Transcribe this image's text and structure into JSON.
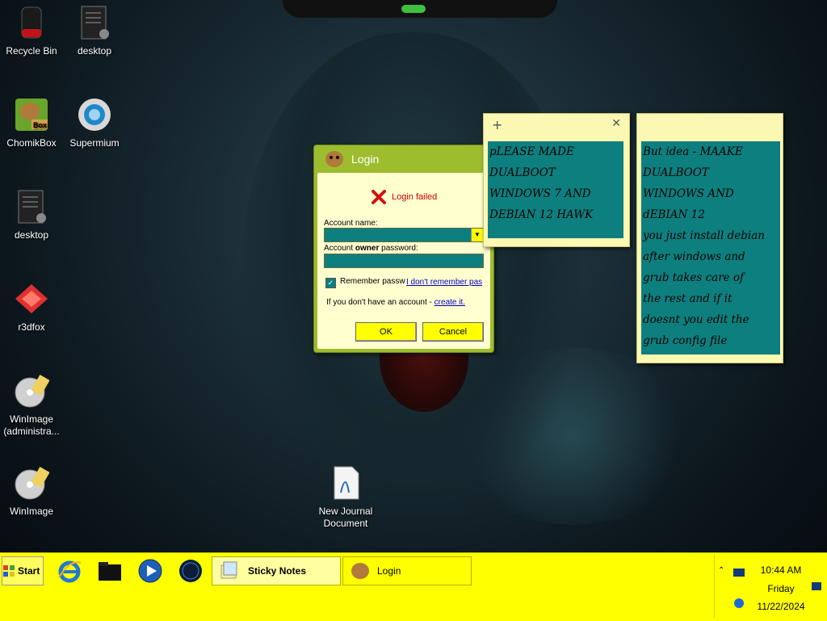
{
  "desktop": {
    "icons": [
      {
        "label": "Recycle Bin",
        "icon": "recycle-bin-icon"
      },
      {
        "label": "desktop",
        "icon": "file-icon"
      },
      {
        "label": "ChomikBox",
        "icon": "chomikbox-icon"
      },
      {
        "label": "Supermium",
        "icon": "supermium-browser-icon"
      },
      {
        "label": "desktop",
        "icon": "file-icon"
      },
      {
        "label": "r3dfox",
        "icon": "r3dfox-browser-icon"
      },
      {
        "label": "WinImage\n(administra...",
        "icon": "winimage-icon"
      },
      {
        "label": "WinImage",
        "icon": "winimage-icon"
      },
      {
        "label": "New Journal\nDocument",
        "icon": "journal-document-icon"
      }
    ]
  },
  "login_window": {
    "title": "Login",
    "error": "Login failed",
    "account_name_label": "Account name:",
    "account_name_value": "",
    "password_label_prefix": "Account ",
    "password_label_bold": "owner",
    "password_label_suffix": " password:",
    "password_value": "",
    "remember_label": "Remember passw",
    "remember_checked": true,
    "forgot_link": "I don't remember pas",
    "no_account_text": "If you don't have an account - ",
    "create_link": "create it.",
    "ok_label": "OK",
    "cancel_label": "Cancel"
  },
  "sticky_notes": [
    {
      "text": "pLEASE MADE\nDUALBOOT\nWINDOWS 7 AND\nDEBIAN 12 HAWK"
    },
    {
      "text": "But idea - MAAKE\nDUALBOOT\nWINDOWS AND\ndEBIAN 12\nyou just install debian\nafter windows and\ngrub takes care of\nthe rest and if it\ndoesnt you edit the\ngrub config file"
    }
  ],
  "taskbar": {
    "start_label": "Start",
    "quick_launch": [
      "internet-explorer-icon",
      "folder-icon",
      "media-player-icon",
      "globe-icon"
    ],
    "tasks": [
      {
        "label": "Sticky Notes",
        "active": true
      },
      {
        "label": "Login",
        "active": false
      }
    ],
    "clock": {
      "time": "10:44 AM",
      "day": "Friday",
      "date": "11/22/2024"
    }
  },
  "colors": {
    "taskbar": "#ffff00",
    "note_bg": "#fbf8b3",
    "note_text_bg": "#0e7f7f",
    "login_frame": "#9dbd2e",
    "login_body": "#ffffd0",
    "error": "#cc0000"
  }
}
